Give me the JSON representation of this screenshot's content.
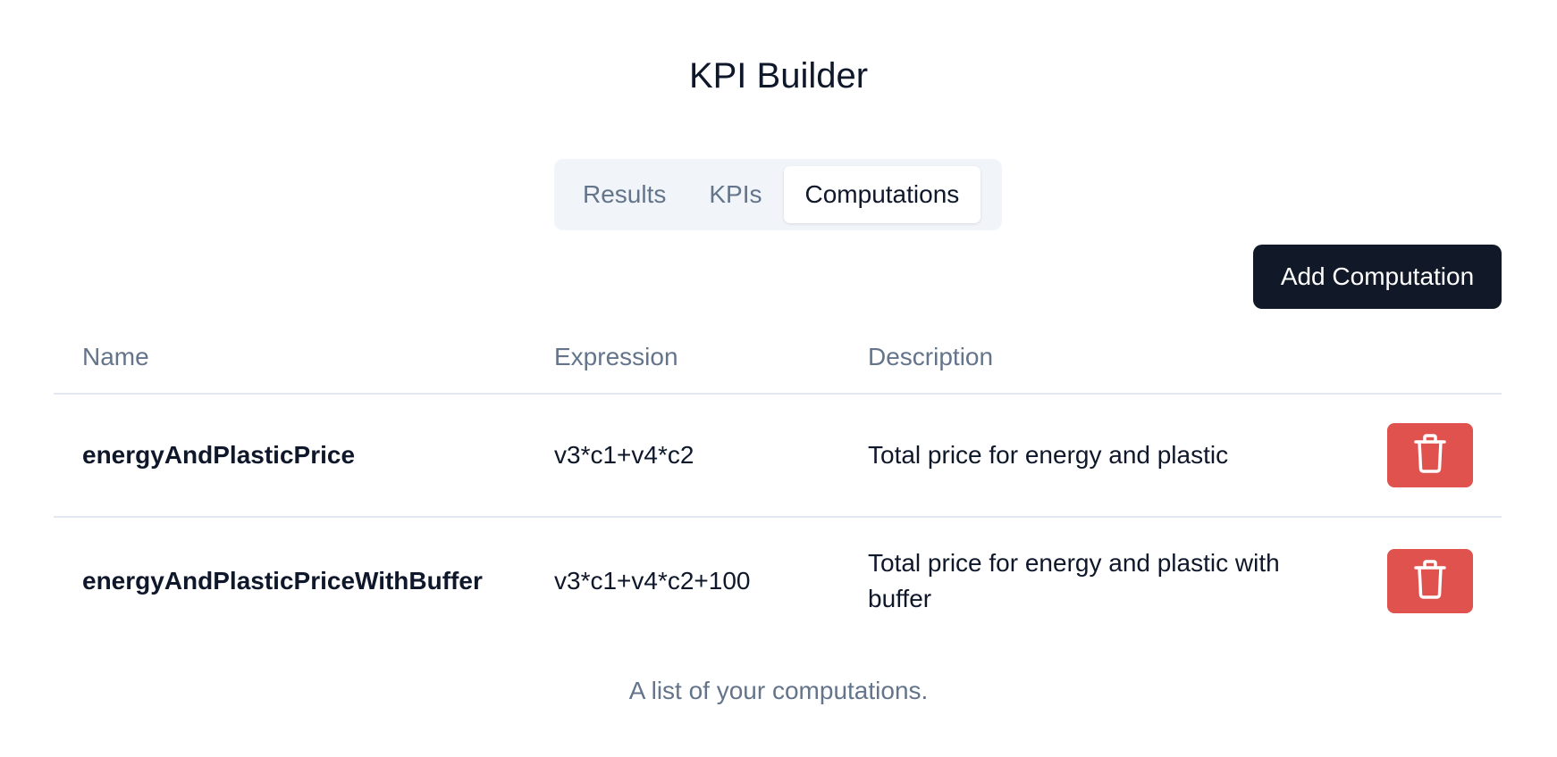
{
  "header": {
    "title": "KPI Builder"
  },
  "tabs": [
    {
      "label": "Results",
      "active": false
    },
    {
      "label": "KPIs",
      "active": false
    },
    {
      "label": "Computations",
      "active": true
    }
  ],
  "toolbar": {
    "add_label": "Add Computation"
  },
  "table": {
    "columns": [
      "Name",
      "Expression",
      "Description"
    ],
    "rows": [
      {
        "name": "energyAndPlasticPrice",
        "expression": "v3*c1+v4*c2",
        "description": "Total price for energy and plastic"
      },
      {
        "name": "energyAndPlasticPriceWithBuffer",
        "expression": "v3*c1+v4*c2+100",
        "description": "Total price for energy and plastic with buffer"
      }
    ],
    "caption": "A list of your computations."
  },
  "icons": {
    "delete": "trash-icon"
  },
  "colors": {
    "primary_button": "#111827",
    "danger": "#e0524e",
    "muted_text": "#64748b",
    "tab_background": "#f1f5f9"
  }
}
